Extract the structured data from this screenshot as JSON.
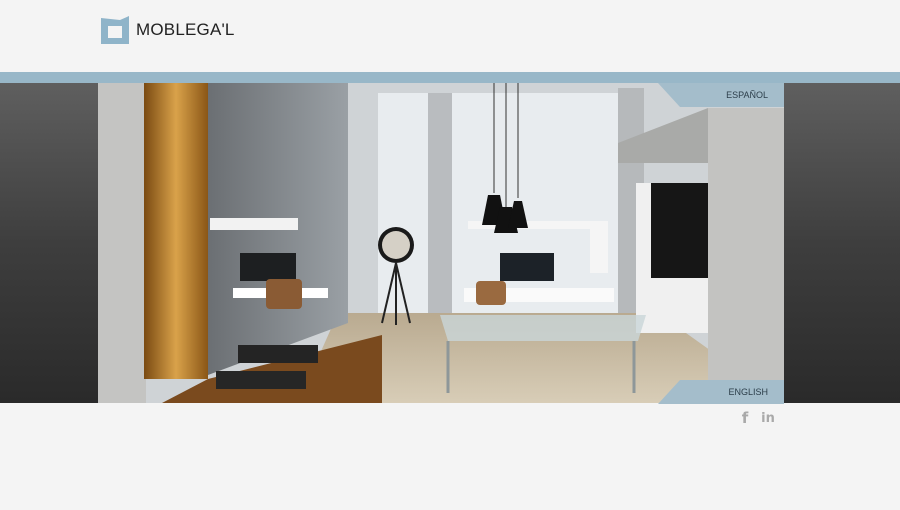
{
  "brand": {
    "name": "MOBLEGA'L",
    "logo_color": "#8fb4c9"
  },
  "languages": {
    "spanish_label": "ESPAÑOL",
    "english_label": "ENGLISH"
  },
  "social": {
    "facebook_icon": "f",
    "linkedin_icon": "in"
  },
  "colors": {
    "accent": "#98b7c8",
    "tab": "#a4bdcb",
    "background": "#f4f4f4"
  }
}
